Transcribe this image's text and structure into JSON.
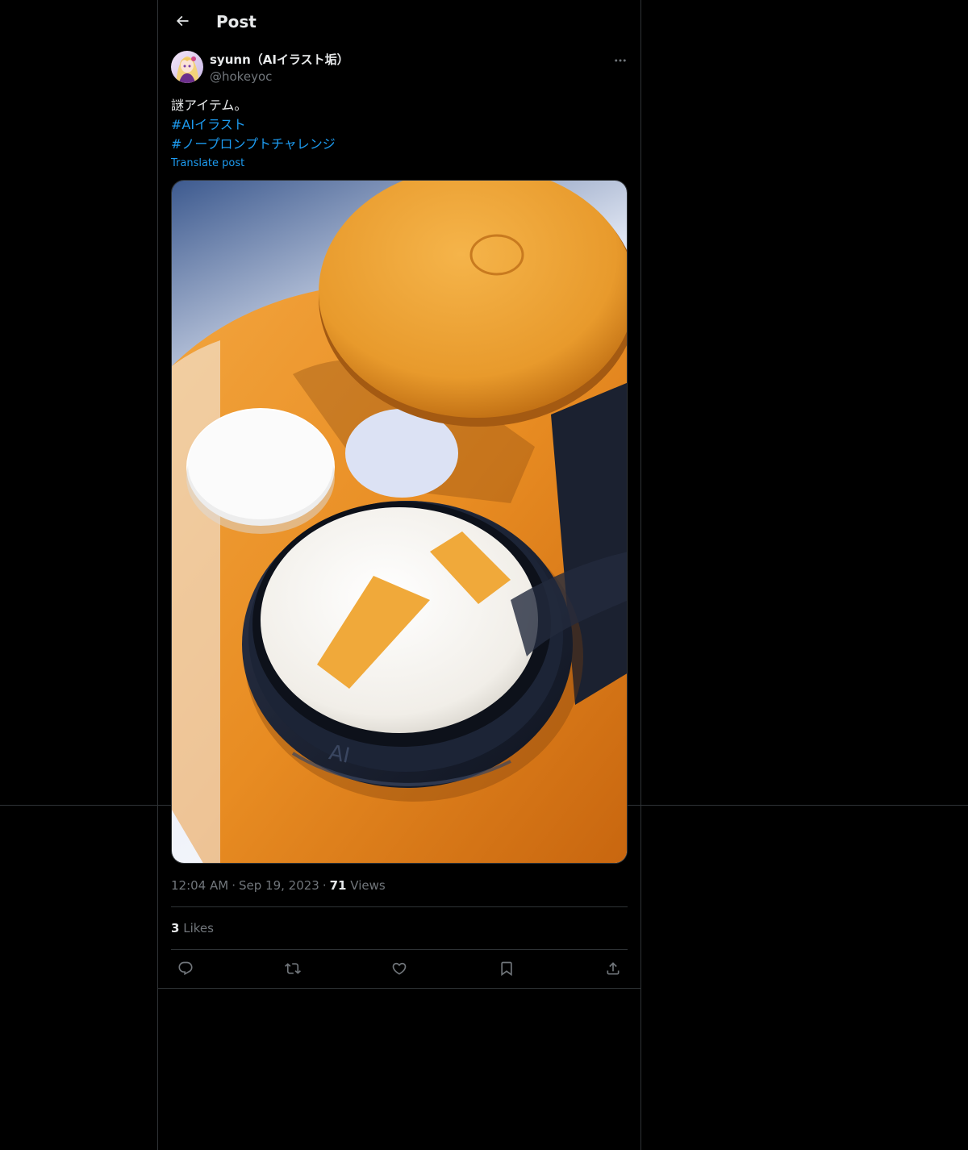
{
  "header": {
    "title": "Post",
    "back_icon": "arrow-left-icon"
  },
  "author": {
    "display_name": "syunn（AIイラスト垢）",
    "handle": "@hokeyoc",
    "more_icon": "more-horizontal-icon"
  },
  "post": {
    "text": "謎アイテム。",
    "hashtags": [
      "#AIイラスト",
      "#ノープロンプトチャレンジ"
    ],
    "translate_label": "Translate post",
    "image_text": "AI"
  },
  "meta": {
    "time": "12:04 AM",
    "separator": "·",
    "date": "Sep 19, 2023",
    "views_count": "71",
    "views_label": "Views"
  },
  "stats": {
    "likes_count": "3",
    "likes_label": "Likes"
  },
  "actions": [
    {
      "name": "reply",
      "icon": "reply-icon"
    },
    {
      "name": "repost",
      "icon": "repost-icon"
    },
    {
      "name": "like",
      "icon": "heart-icon"
    },
    {
      "name": "bookmark",
      "icon": "bookmark-icon"
    },
    {
      "name": "share",
      "icon": "share-icon"
    }
  ],
  "colors": {
    "background": "#000000",
    "text": "#e7e9ea",
    "secondary_text": "#71767b",
    "accent": "#1d9bf0",
    "border": "#2f3336"
  }
}
